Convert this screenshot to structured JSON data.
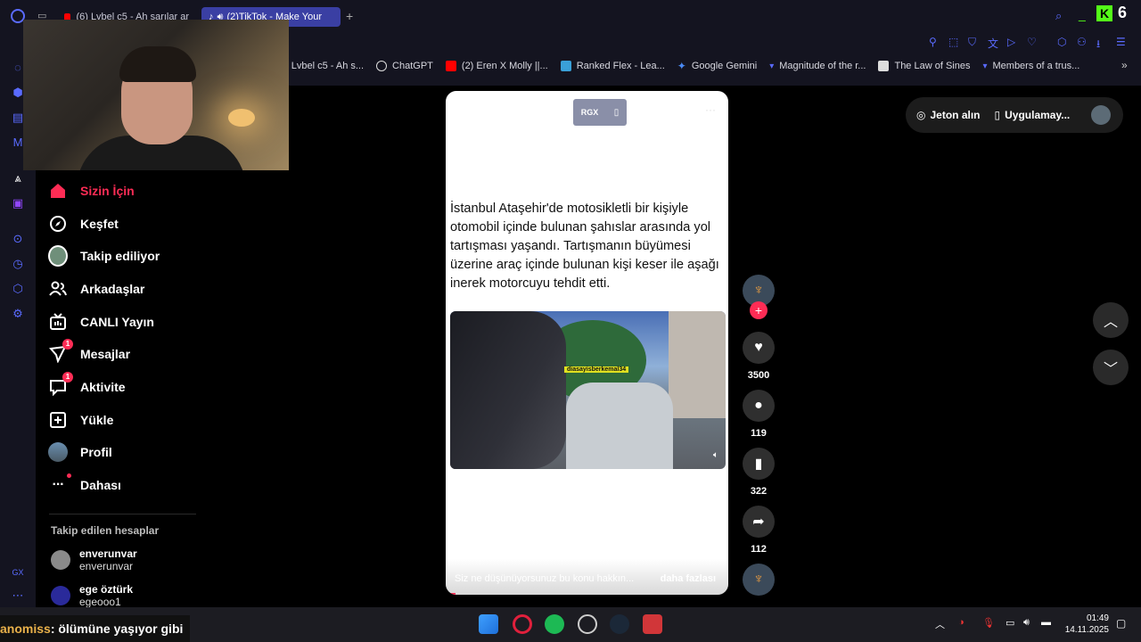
{
  "browser": {
    "tabs": [
      {
        "label": "(6) Lvbel c5 - Ah sarılar ar",
        "active": false
      },
      {
        "label": "(2)TikTok - Make Your",
        "active": true
      }
    ],
    "bookmarks": [
      {
        "label": ") Lvbel c5 - Ah s...",
        "color": "#ff0000"
      },
      {
        "label": "ChatGPT",
        "color": "#dddddd"
      },
      {
        "label": "(2) Eren X Molly ||...",
        "color": "#ff0000"
      },
      {
        "label": "Ranked Flex - Lea...",
        "color": "#3aa0d8"
      },
      {
        "label": "Google Gemini",
        "color": "#4a8af4"
      },
      {
        "label": "Magnitude of the r...",
        "color": "#3a3fa3"
      },
      {
        "label": "The Law of Sines",
        "color": "#dddddd"
      },
      {
        "label": "Members of a trus...",
        "color": "#3a3fa3"
      }
    ],
    "kick_count": "6"
  },
  "nav": {
    "items": [
      {
        "label": "Sizin İçin",
        "icon": "home-icon"
      },
      {
        "label": "Keşfet",
        "icon": "compass-icon"
      },
      {
        "label": "Takip ediliyor",
        "icon": "avatar"
      },
      {
        "label": "Arkadaşlar",
        "icon": "friends-icon"
      },
      {
        "label": "CANLI Yayın",
        "icon": "live-icon"
      },
      {
        "label": "Mesajlar",
        "icon": "message-icon",
        "badge": "1"
      },
      {
        "label": "Aktivite",
        "icon": "activity-icon",
        "badge": "1"
      },
      {
        "label": "Yükle",
        "icon": "upload-icon"
      },
      {
        "label": "Profil",
        "icon": "avatar"
      },
      {
        "label": "Dahası",
        "icon": "more-icon"
      }
    ],
    "followed_title": "Takip edilen hesaplar",
    "accounts": [
      {
        "name": "enverunvar",
        "user": "enverunvar"
      },
      {
        "name": "ege öztürk",
        "user": "egeooo1"
      }
    ]
  },
  "post": {
    "caption": "İstanbul Ataşehir'de motosikletli bir kişiyle otomobil içinde bulunan şahıslar arasında yol tartışması yaşandı. Tartışmanın büyümesi üzerine araç içinde bulunan kişi keser ile aşağı inerek motorcuyu tehdit etti.",
    "video_tag": "diasayisberkemal34",
    "badge_text": "RGX",
    "comment_placeholder": "Siz ne düşünüyorsunuz bu konu hakkın...",
    "more_label": "daha fazlası"
  },
  "actions": {
    "likes": "3500",
    "comments": "119",
    "saves": "322",
    "shares": "112"
  },
  "topbar": {
    "coins_label": "Jeton alın",
    "app_label": "Uygulamay..."
  },
  "stream": {
    "chat_user": "anomiss",
    "chat_message": ": ölümüne yaşıyor gibi"
  },
  "system": {
    "time": "01:49",
    "date": "14.11.2025"
  }
}
